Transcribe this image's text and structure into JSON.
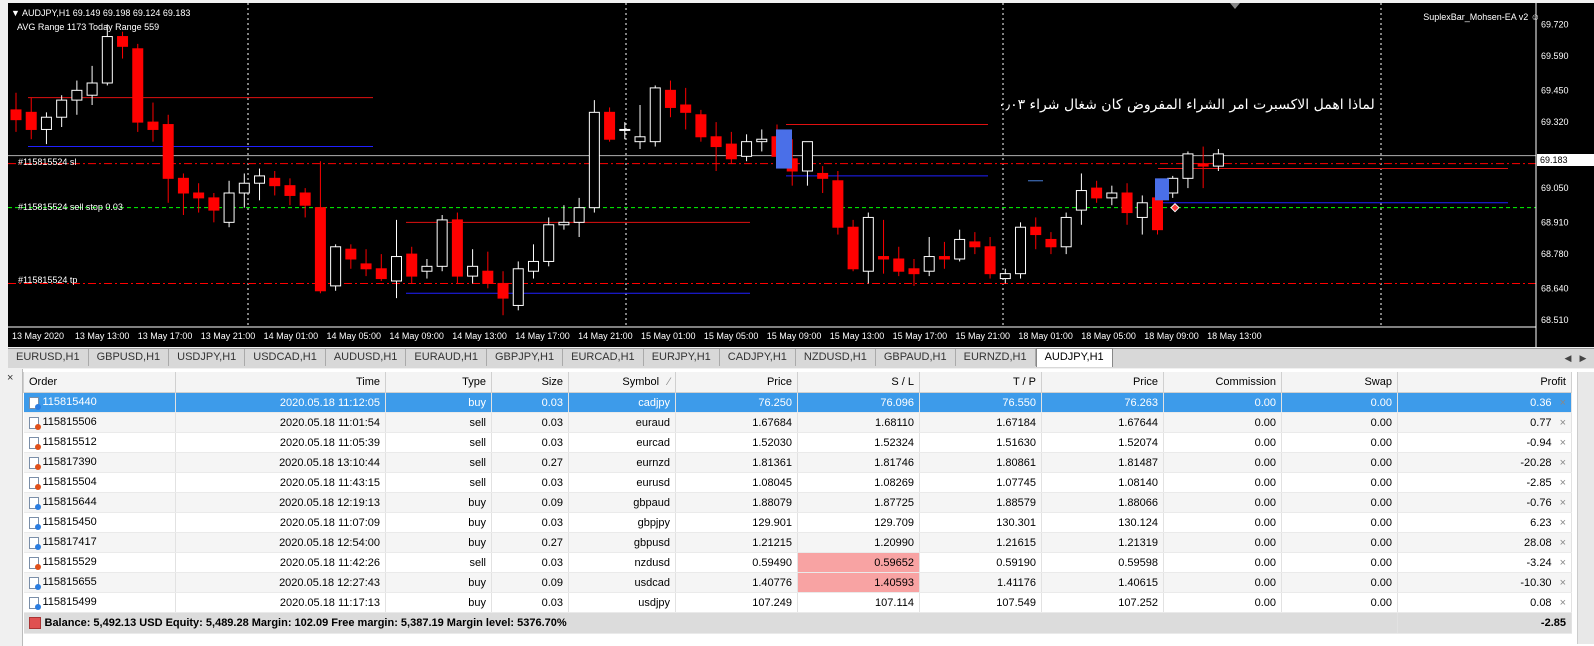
{
  "chart": {
    "header": "AUDJPY,H1  69.149 69.198 69.124 69.183",
    "ranges": "AVG Range 1173   Today Range 559",
    "ea_name": "SuplexBar_Mohsen-EA v2",
    "annotation": "لماذا اهمل الاكسبرت امر الشراء المفروض كان شغال شراء ۰٫۰۳",
    "order_labels": [
      "#115815524 sl",
      "#115815524 sell stop 0.03",
      "#115815524 tp"
    ],
    "price_labels": [
      "69.720",
      "69.590",
      "69.450",
      "69.320",
      "69.183",
      "69.050",
      "68.910",
      "68.780",
      "68.640",
      "68.510"
    ],
    "time_labels": [
      "13 May 2020",
      "13 May 13:00",
      "13 May 17:00",
      "13 May 21:00",
      "14 May 01:00",
      "14 May 05:00",
      "14 May 09:00",
      "14 May 13:00",
      "14 May 17:00",
      "14 May 21:00",
      "15 May 01:00",
      "15 May 05:00",
      "15 May 09:00",
      "15 May 13:00",
      "15 May 17:00",
      "15 May 21:00",
      "18 May 01:00",
      "18 May 05:00",
      "18 May 09:00",
      "18 May 13:00"
    ],
    "current_price": 69.183,
    "candles_ohlc": [
      [
        69.37,
        69.44,
        69.28,
        69.33
      ],
      [
        69.36,
        69.42,
        69.25,
        69.29
      ],
      [
        69.29,
        69.36,
        69.23,
        69.34
      ],
      [
        69.34,
        69.43,
        69.3,
        69.41
      ],
      [
        69.41,
        69.49,
        69.35,
        69.45
      ],
      [
        69.43,
        69.55,
        69.39,
        69.48
      ],
      [
        69.48,
        69.72,
        69.47,
        69.67
      ],
      [
        69.67,
        69.69,
        69.58,
        69.63
      ],
      [
        69.62,
        69.64,
        69.28,
        69.32
      ],
      [
        69.32,
        69.4,
        69.24,
        69.29
      ],
      [
        69.31,
        69.35,
        68.99,
        69.09
      ],
      [
        69.09,
        69.11,
        68.94,
        69.03
      ],
      [
        69.03,
        69.07,
        68.95,
        69.01
      ],
      [
        69.01,
        69.03,
        68.91,
        68.96
      ],
      [
        68.91,
        69.08,
        68.89,
        69.03
      ],
      [
        69.03,
        69.11,
        68.97,
        69.07
      ],
      [
        69.07,
        69.13,
        69.0,
        69.1
      ],
      [
        69.09,
        69.12,
        69.02,
        69.06
      ],
      [
        69.06,
        69.09,
        68.98,
        69.02
      ],
      [
        69.03,
        69.05,
        68.93,
        68.98
      ],
      [
        68.97,
        69.16,
        68.62,
        68.63
      ],
      [
        68.65,
        68.82,
        68.63,
        68.81
      ],
      [
        68.8,
        68.82,
        68.72,
        68.76
      ],
      [
        68.74,
        68.8,
        68.69,
        68.72
      ],
      [
        68.72,
        68.78,
        68.67,
        68.68
      ],
      [
        68.67,
        68.92,
        68.6,
        68.77
      ],
      [
        68.78,
        68.81,
        68.66,
        68.69
      ],
      [
        68.71,
        68.76,
        68.68,
        68.73
      ],
      [
        68.73,
        68.94,
        68.71,
        68.92
      ],
      [
        68.92,
        68.95,
        68.66,
        68.69
      ],
      [
        68.69,
        68.8,
        68.66,
        68.73
      ],
      [
        68.71,
        68.79,
        68.64,
        68.66
      ],
      [
        68.66,
        68.71,
        68.53,
        68.6
      ],
      [
        68.57,
        68.75,
        68.55,
        68.72
      ],
      [
        68.71,
        68.82,
        68.68,
        68.75
      ],
      [
        68.75,
        68.93,
        68.73,
        68.9
      ],
      [
        68.9,
        68.98,
        68.88,
        68.91
      ],
      [
        68.91,
        69.01,
        68.85,
        68.97
      ],
      [
        68.97,
        69.41,
        68.95,
        69.36
      ],
      [
        69.36,
        69.38,
        69.24,
        69.25
      ],
      [
        69.29,
        69.32,
        69.25,
        69.29
      ],
      [
        69.24,
        69.39,
        69.21,
        69.26
      ],
      [
        69.24,
        69.47,
        69.22,
        69.46
      ],
      [
        69.45,
        69.49,
        69.34,
        69.38
      ],
      [
        69.39,
        69.46,
        69.29,
        69.36
      ],
      [
        69.35,
        69.37,
        69.24,
        69.26
      ],
      [
        69.26,
        69.32,
        69.12,
        69.22
      ],
      [
        69.23,
        69.28,
        69.15,
        69.17
      ],
      [
        69.18,
        69.27,
        69.16,
        69.24
      ],
      [
        69.24,
        69.29,
        69.2,
        69.25
      ],
      [
        69.26,
        69.31,
        69.21,
        69.18
      ],
      [
        69.17,
        69.25,
        69.06,
        69.12
      ],
      [
        69.12,
        69.21,
        69.06,
        69.24
      ],
      [
        69.11,
        69.14,
        69.03,
        69.09
      ],
      [
        69.08,
        69.12,
        68.86,
        68.89
      ],
      [
        68.89,
        68.92,
        68.71,
        68.72
      ],
      [
        68.71,
        68.95,
        68.66,
        68.93
      ],
      [
        68.77,
        68.92,
        68.7,
        68.76
      ],
      [
        68.76,
        68.81,
        68.69,
        68.71
      ],
      [
        68.72,
        68.76,
        68.65,
        68.7
      ],
      [
        68.71,
        68.85,
        68.69,
        68.77
      ],
      [
        68.77,
        68.83,
        68.72,
        68.76
      ],
      [
        68.76,
        68.88,
        68.75,
        68.84
      ],
      [
        68.83,
        68.87,
        68.78,
        68.81
      ],
      [
        68.81,
        68.85,
        68.68,
        68.7
      ],
      [
        68.68,
        68.72,
        68.66,
        68.7
      ],
      [
        68.7,
        68.91,
        68.68,
        68.89
      ],
      [
        68.89,
        68.93,
        68.8,
        68.86
      ],
      [
        68.84,
        68.87,
        68.78,
        68.81
      ],
      [
        68.81,
        68.95,
        68.78,
        68.93
      ],
      [
        68.96,
        69.11,
        68.9,
        69.04
      ],
      [
        69.05,
        69.08,
        68.99,
        69.01
      ],
      [
        69.01,
        69.06,
        68.98,
        69.03
      ],
      [
        69.03,
        69.07,
        68.9,
        68.95
      ],
      [
        68.93,
        69.02,
        68.86,
        68.99
      ],
      [
        69.01,
        69.04,
        68.86,
        68.88
      ],
      [
        69.03,
        69.1,
        69.01,
        69.09
      ],
      [
        69.09,
        69.2,
        69.05,
        69.19
      ],
      [
        69.15,
        69.22,
        69.05,
        69.14
      ],
      [
        69.14,
        69.21,
        69.12,
        69.19
      ]
    ]
  },
  "tabs": [
    "EURUSD,H1",
    "GBPUSD,H1",
    "USDJPY,H1",
    "USDCAD,H1",
    "AUDUSD,H1",
    "EURAUD,H1",
    "GBPJPY,H1",
    "EURCAD,H1",
    "EURJPY,H1",
    "CADJPY,H1",
    "NZDUSD,H1",
    "GBPAUD,H1",
    "EURNZD,H1",
    "AUDJPY,H1"
  ],
  "active_tab": "AUDJPY,H1",
  "columns": [
    "Order",
    "Time",
    "Type",
    "Size",
    "Symbol",
    "Price",
    "S / L",
    "T / P",
    "Price",
    "Commission",
    "Swap",
    "Profit"
  ],
  "symbol_sort_indicator": "⁄",
  "rows": [
    {
      "order": "115815440",
      "time": "2020.05.18 11:12:05",
      "type": "buy",
      "size": "0.03",
      "symbol": "cadjpy",
      "price": "76.250",
      "sl": "76.096",
      "tp": "76.550",
      "cur": "76.263",
      "commission": "0.00",
      "swap": "0.00",
      "profit": "0.36"
    },
    {
      "order": "115815506",
      "time": "2020.05.18 11:01:54",
      "type": "sell",
      "size": "0.03",
      "symbol": "euraud",
      "price": "1.67684",
      "sl": "1.68110",
      "tp": "1.67184",
      "cur": "1.67644",
      "commission": "0.00",
      "swap": "0.00",
      "profit": "0.77"
    },
    {
      "order": "115815512",
      "time": "2020.05.18 11:05:39",
      "type": "sell",
      "size": "0.03",
      "symbol": "eurcad",
      "price": "1.52030",
      "sl": "1.52324",
      "tp": "1.51630",
      "cur": "1.52074",
      "commission": "0.00",
      "swap": "0.00",
      "profit": "-0.94"
    },
    {
      "order": "115817390",
      "time": "2020.05.18 13:10:44",
      "type": "sell",
      "size": "0.27",
      "symbol": "eurnzd",
      "price": "1.81361",
      "sl": "1.81746",
      "tp": "1.80861",
      "cur": "1.81487",
      "commission": "0.00",
      "swap": "0.00",
      "profit": "-20.28"
    },
    {
      "order": "115815504",
      "time": "2020.05.18 11:43:15",
      "type": "sell",
      "size": "0.03",
      "symbol": "eurusd",
      "price": "1.08045",
      "sl": "1.08269",
      "tp": "1.07745",
      "cur": "1.08140",
      "commission": "0.00",
      "swap": "0.00",
      "profit": "-2.85"
    },
    {
      "order": "115815644",
      "time": "2020.05.18 12:19:13",
      "type": "buy",
      "size": "0.09",
      "symbol": "gbpaud",
      "price": "1.88079",
      "sl": "1.87725",
      "tp": "1.88579",
      "cur": "1.88066",
      "commission": "0.00",
      "swap": "0.00",
      "profit": "-0.76"
    },
    {
      "order": "115815450",
      "time": "2020.05.18 11:07:09",
      "type": "buy",
      "size": "0.03",
      "symbol": "gbpjpy",
      "price": "129.901",
      "sl": "129.709",
      "tp": "130.301",
      "cur": "130.124",
      "commission": "0.00",
      "swap": "0.00",
      "profit": "6.23"
    },
    {
      "order": "115817417",
      "time": "2020.05.18 12:54:00",
      "type": "buy",
      "size": "0.27",
      "symbol": "gbpusd",
      "price": "1.21215",
      "sl": "1.20990",
      "tp": "1.21615",
      "cur": "1.21319",
      "commission": "0.00",
      "swap": "0.00",
      "profit": "28.08"
    },
    {
      "order": "115815529",
      "time": "2020.05.18 11:42:26",
      "type": "sell",
      "size": "0.03",
      "symbol": "nzdusd",
      "price": "0.59490",
      "sl": "0.59652",
      "tp": "0.59190",
      "cur": "0.59598",
      "commission": "0.00",
      "swap": "0.00",
      "profit": "-3.24"
    },
    {
      "order": "115815655",
      "time": "2020.05.18 12:27:43",
      "type": "buy",
      "size": "0.09",
      "symbol": "usdcad",
      "price": "1.40776",
      "sl": "1.40593",
      "tp": "1.41176",
      "cur": "1.40615",
      "commission": "0.00",
      "swap": "0.00",
      "profit": "-10.30"
    },
    {
      "order": "115815499",
      "time": "2020.05.18 11:17:13",
      "type": "buy",
      "size": "0.03",
      "symbol": "usdjpy",
      "price": "107.249",
      "sl": "107.114",
      "tp": "107.549",
      "cur": "107.252",
      "commission": "0.00",
      "swap": "0.00",
      "profit": "0.08"
    }
  ],
  "balance_line": "Balance: 5,492.13 USD  Equity: 5,489.28  Margin: 102.09  Free margin: 5,387.19  Margin level: 5376.70%",
  "total_profit": "-2.85",
  "close_glyph": "×",
  "side_close": "×",
  "colors": {
    "bull": "#ffffff",
    "bear": "#ff0000",
    "highlight_sl": "#f8a3a3",
    "selected_row": "#3d9bea",
    "sl_line": "#ff0000",
    "stop_line": "#00ff00",
    "blue_level": "#2020ff"
  }
}
